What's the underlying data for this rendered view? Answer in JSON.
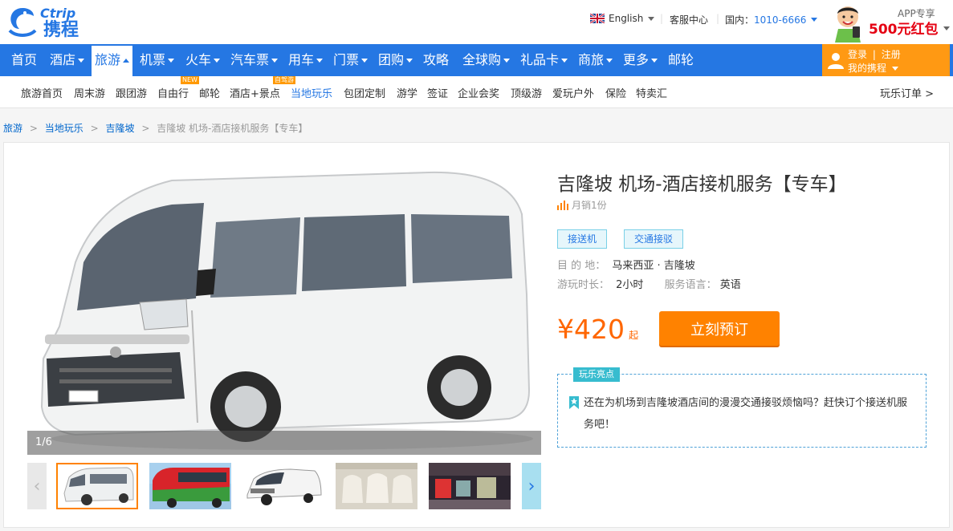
{
  "header": {
    "logo_en": "Ctrip",
    "logo_cn": "携程",
    "language": "English",
    "service_center": "客服中心",
    "phone_label": "国内：",
    "phone": "1010-6666",
    "app_label": "APP专享",
    "app_promo": "500元红包"
  },
  "main_nav": [
    {
      "label": "首页",
      "caret": false
    },
    {
      "label": "酒店",
      "caret": true
    },
    {
      "label": "旅游",
      "caret": true,
      "active": true
    },
    {
      "label": "机票",
      "caret": true
    },
    {
      "label": "火车",
      "caret": true
    },
    {
      "label": "汽车票",
      "caret": true
    },
    {
      "label": "用车",
      "caret": true
    },
    {
      "label": "门票",
      "caret": true
    },
    {
      "label": "团购",
      "caret": true
    },
    {
      "label": "攻略",
      "caret": false
    },
    {
      "label": "全球购",
      "caret": true
    },
    {
      "label": "礼品卡",
      "caret": true
    },
    {
      "label": "商旅",
      "caret": true
    },
    {
      "label": "更多",
      "caret": true
    },
    {
      "label": "邮轮",
      "caret": false
    }
  ],
  "login": {
    "login_label": "登录",
    "register_label": "注册",
    "my_ctrip": "我的携程"
  },
  "sub_nav": {
    "items": [
      "旅游首页",
      "周末游",
      "跟团游",
      "自由行",
      "邮轮",
      "酒店+景点",
      "当地玩乐",
      "包团定制",
      "游学",
      "签证",
      "企业会奖",
      "顶级游",
      "爱玩户外",
      "保险",
      "特卖汇"
    ],
    "badge_new": "NEW",
    "badge_selfdrive": "自驾游",
    "orders": "玩乐订单 >"
  },
  "breadcrumb": {
    "items": [
      "旅游",
      "当地玩乐",
      "吉隆坡"
    ],
    "current": "吉隆坡 机场-酒店接机服务【专车】",
    "sep": ">"
  },
  "gallery": {
    "counter": "1/6"
  },
  "product": {
    "title": "吉隆坡 机场-酒店接机服务【专车】",
    "monthly_sales": "月销1份",
    "tags": [
      "接送机",
      "交通接驳"
    ],
    "dest_label": "目 的 地：",
    "dest_value": "马来西亚 · 吉隆坡",
    "duration_label": "游玩时长：",
    "duration_value": "2小时",
    "language_label": "服务语言：",
    "language_value": "英语",
    "price": "¥420",
    "price_suffix": "起",
    "book_button": "立刻预订",
    "highlight_label": "玩乐亮点",
    "highlight_text": "还在为机场到吉隆坡酒店间的漫漫交通接驳烦恼吗？赶快订个接送机服务吧！"
  },
  "colors": {
    "brand_blue": "#2577e3",
    "orange": "#ff8200",
    "price": "#ff6600",
    "login_bg": "#ff9913"
  }
}
